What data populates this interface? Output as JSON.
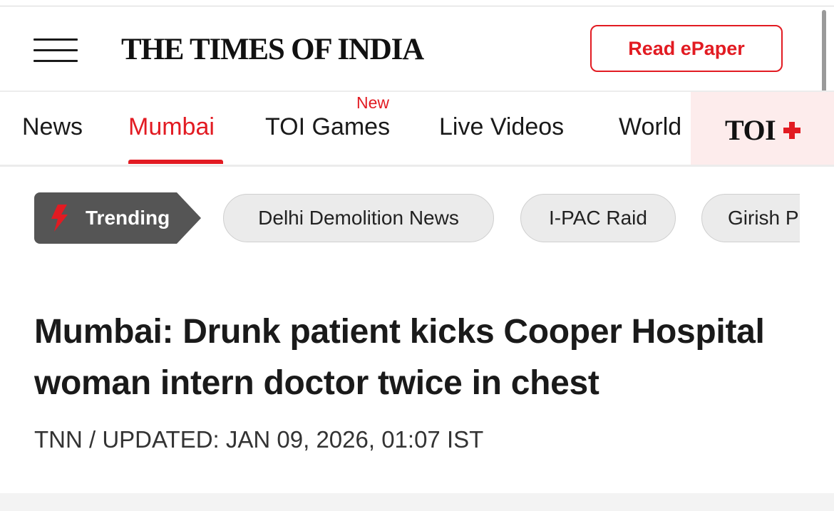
{
  "header": {
    "menu_icon": "hamburger-menu-icon",
    "logo_text": "THE TIMES OF INDIA",
    "epaper_label": "Read ePaper",
    "accent_color": "#e21b22"
  },
  "nav": {
    "items": [
      {
        "label": "News",
        "active": false
      },
      {
        "label": "Mumbai",
        "active": true
      },
      {
        "label": "TOI Games",
        "active": false,
        "badge": "New"
      },
      {
        "label": "Live Videos",
        "active": false
      },
      {
        "label": "World",
        "active": false
      }
    ],
    "toi_plus_label": "TOI",
    "toi_plus_icon": "plus-cross-icon"
  },
  "trending": {
    "label": "Trending",
    "icon": "lightning-bolt-icon",
    "chips": [
      {
        "label": "Delhi Demolition News"
      },
      {
        "label": "I-PAC Raid"
      },
      {
        "label": "Girish P"
      }
    ]
  },
  "article": {
    "headline": "Mumbai: Drunk patient kicks Cooper Hospital woman intern doctor twice in chest",
    "byline": "TNN / UPDATED: JAN 09, 2026, 01:07 IST"
  }
}
